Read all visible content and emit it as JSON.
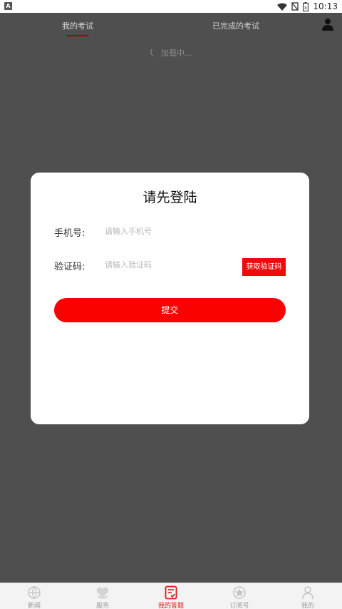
{
  "status_bar": {
    "app_badge": "A",
    "time": "10:13"
  },
  "tabs": [
    {
      "label": "我的考试",
      "active": true
    },
    {
      "label": "已完成的考试",
      "active": false
    }
  ],
  "loading_text": "加载中...",
  "dialog": {
    "title": "请先登陆",
    "phone_label": "手机号:",
    "phone_placeholder": "请输入手机号",
    "phone_value": "",
    "code_label": "验证码:",
    "code_placeholder": "请输入验证码",
    "code_value": "",
    "get_code_label": "获取验证码",
    "submit_label": "提交"
  },
  "bottom_nav": [
    {
      "label": "新闻",
      "icon": "news-icon",
      "active": false
    },
    {
      "label": "服务",
      "icon": "service-icon",
      "active": false
    },
    {
      "label": "我的答题",
      "icon": "answer-icon",
      "active": true
    },
    {
      "label": "订阅号",
      "icon": "subscription-icon",
      "active": false
    },
    {
      "label": "我的",
      "icon": "profile-icon",
      "active": false
    }
  ],
  "colors": {
    "accent": "#fb0202",
    "overlay_bg": "#4f4f4f",
    "active_nav": "#e0191b"
  }
}
